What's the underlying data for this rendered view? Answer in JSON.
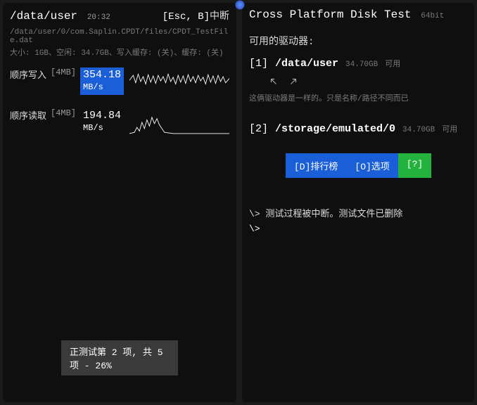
{
  "left": {
    "path": "/data/user",
    "time": "20:32",
    "esc_label_prefix": "[Esc, B]",
    "esc_label_suffix": "中断",
    "filepath": "/data/user/0/com.Saplin.CPDT/files/CPDT_TestFile.dat",
    "fileinfo": "大小: 1GB、空闲: 34.7GB、写入缓存: (关)、缓存: (关)",
    "rows": [
      {
        "label": "顺序写入",
        "size": "[4MB]",
        "value": "354.18",
        "unit": "MB/s",
        "highlight": true
      },
      {
        "label": "顺序读取",
        "size": "[4MB]",
        "value": "194.84",
        "unit": "MB/s",
        "highlight": false
      }
    ],
    "progress": "正测试第 2 项, 共 5 项 - 26%"
  },
  "right": {
    "title": "Cross Platform Disk Test",
    "bit": "64bit",
    "drives_heading": "可用的驱动器:",
    "drives": [
      {
        "idx": "[1]",
        "path": "/data/user",
        "size": "34.70GB",
        "avail": "可用"
      },
      {
        "idx": "[2]",
        "path": "/storage/emulated/0",
        "size": "34.70GB",
        "avail": "可用"
      }
    ],
    "note": "这俩驱动器是一样的。只是名称/路径不同而已",
    "buttons": {
      "ranking": "[D]排行榜",
      "options": "[O]选项",
      "help": "[?]"
    },
    "console": [
      "\\> 测试过程被中断。测试文件已删除",
      "\\>"
    ]
  }
}
